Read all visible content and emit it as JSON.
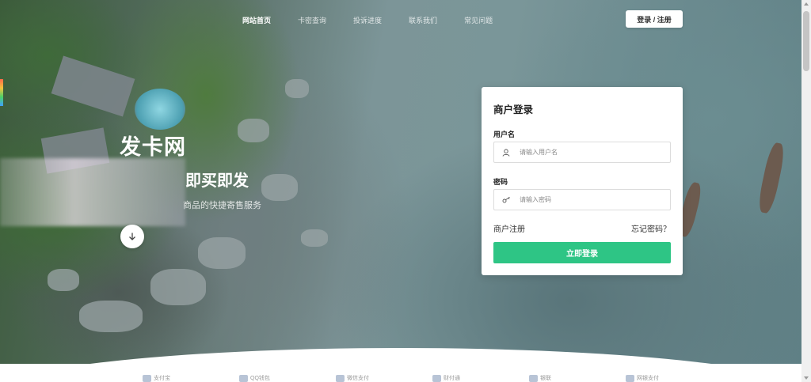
{
  "nav": {
    "items": [
      {
        "label": "网站首页",
        "active": true
      },
      {
        "label": "卡密查询",
        "active": false
      },
      {
        "label": "投诉进度",
        "active": false
      },
      {
        "label": "联系我们",
        "active": false
      },
      {
        "label": "常见问题",
        "active": false
      }
    ],
    "login_register": "登录 / 注册"
  },
  "hero": {
    "brand": "发卡网",
    "slogan": "即买即发",
    "subline": "商品的快捷寄售服务",
    "down_icon": "arrow-down-icon"
  },
  "login_card": {
    "title": "商户登录",
    "username_label": "用户名",
    "username_placeholder": "请输入用户名",
    "password_label": "密码",
    "password_placeholder": "请输入密码",
    "register_link": "商户注册",
    "forgot_link": "忘记密码？",
    "submit_label": "立即登录",
    "accent_color": "#2ec585"
  },
  "payments": [
    {
      "label": "支付宝",
      "icon": "alipay-icon"
    },
    {
      "label": "QQ钱包",
      "icon": "qq-wallet-icon"
    },
    {
      "label": "微信支付",
      "icon": "wechat-pay-icon"
    },
    {
      "label": "财付通",
      "icon": "tenpay-icon"
    },
    {
      "label": "银联",
      "icon": "unionpay-icon"
    },
    {
      "label": "网银支付",
      "icon": "bank-icon"
    }
  ]
}
